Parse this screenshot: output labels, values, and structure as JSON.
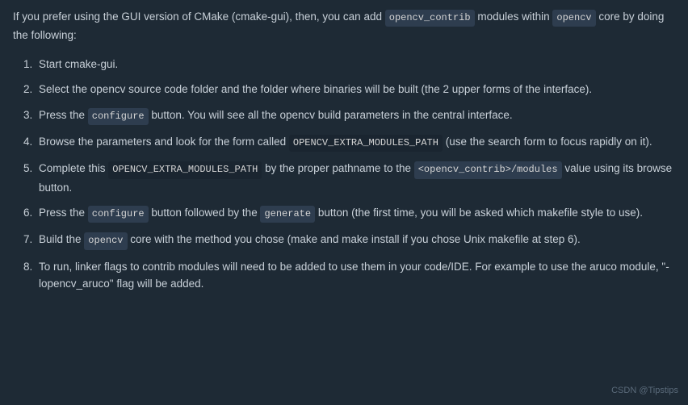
{
  "intro": {
    "text_before": "If you prefer using the GUI version of CMake (cmake-gui), then, you can add",
    "tag1": "opencv_contrib",
    "text_middle": "modules within",
    "tag2": "opencv",
    "text_after": "core by doing the following:"
  },
  "steps": [
    {
      "id": 1,
      "text": "Start cmake-gui."
    },
    {
      "id": 2,
      "text": "Select the opencv source code folder and the folder where binaries will be built (the 2 upper forms of the interface)."
    },
    {
      "id": 3,
      "part1": "Press the",
      "tag": "configure",
      "part2": "button. You will see all the opencv build parameters in the central interface."
    },
    {
      "id": 4,
      "part1": "Browse the parameters and look for the form called",
      "tag": "OPENCV_EXTRA_MODULES_PATH",
      "part2": "(use the search form to focus rapidly on it)."
    },
    {
      "id": 5,
      "part1": "Complete this",
      "tag1": "OPENCV_EXTRA_MODULES_PATH",
      "part2": "by the proper pathname to the",
      "tag2": "<opencv_contrib>/modules",
      "part3": "value using its browse button."
    },
    {
      "id": 6,
      "part1": "Press the",
      "tag1": "configure",
      "part2": "button followed by the",
      "tag2": "generate",
      "part3": "button (the first time, you will be asked which makefile style to use)."
    },
    {
      "id": 7,
      "part1": "Build the",
      "tag": "opencv",
      "part2": "core with the method you chose (make and make install if you chose Unix makefile at step 6)."
    },
    {
      "id": 8,
      "text": "To run, linker flags to contrib modules will need to be added to use them in your code/IDE. For example to use the aruco module, \"-lopencv_aruco\" flag will be added."
    }
  ],
  "watermark": "CSDN @Tipstips"
}
